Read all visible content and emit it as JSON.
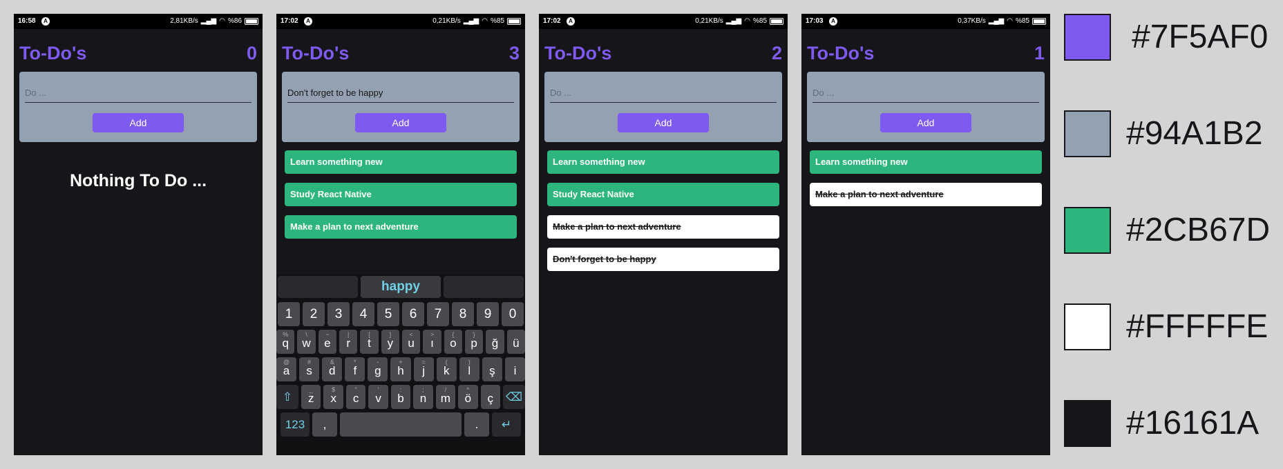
{
  "app_title": "To-Do's",
  "placeholder": "Do ...",
  "add_label": "Add",
  "empty_text": "Nothing To Do ...",
  "screens": [
    {
      "status": {
        "time": "16:58",
        "net": "2,81KB/s",
        "battery": "%86"
      },
      "count": "0",
      "input_value": "",
      "todos": []
    },
    {
      "status": {
        "time": "17:02",
        "net": "0,21KB/s",
        "battery": "%85"
      },
      "count": "3",
      "input_value": "Don't forget to be happy",
      "todos": [
        {
          "text": "Learn something new",
          "done": false
        },
        {
          "text": "Study React Native",
          "done": false
        },
        {
          "text": "Make a plan to next adventure",
          "done": false
        }
      ]
    },
    {
      "status": {
        "time": "17:02",
        "net": "0,21KB/s",
        "battery": "%85"
      },
      "count": "2",
      "input_value": "",
      "todos": [
        {
          "text": "Learn something new",
          "done": false
        },
        {
          "text": "Study React Native",
          "done": false
        },
        {
          "text": "Make a plan to next adventure",
          "done": true
        },
        {
          "text": "Don't forget to be happy",
          "done": true
        }
      ]
    },
    {
      "status": {
        "time": "17:03",
        "net": "0,37KB/s",
        "battery": "%85"
      },
      "count": "1",
      "input_value": "",
      "todos": [
        {
          "text": "Learn something new",
          "done": false
        },
        {
          "text": "Make a plan to next adventure",
          "done": true
        }
      ]
    }
  ],
  "keyboard": {
    "suggestion": "happy",
    "numbers": [
      "1",
      "2",
      "3",
      "4",
      "5",
      "6",
      "7",
      "8",
      "9",
      "0"
    ],
    "row1": [
      "q",
      "w",
      "e",
      "r",
      "t",
      "y",
      "u",
      "ı",
      "o",
      "p",
      "ğ",
      "ü"
    ],
    "row1_sub": [
      "%",
      "\\",
      "~",
      "|",
      "[",
      "]",
      "<",
      ">",
      "{",
      "}",
      "",
      ""
    ],
    "row2": [
      "a",
      "s",
      "d",
      "f",
      "g",
      "h",
      "j",
      "k",
      "l",
      "ş",
      "i"
    ],
    "row2_sub": [
      "@",
      "#",
      "&",
      "*",
      "-",
      "+",
      "=",
      "(",
      ")",
      "",
      ""
    ],
    "row3": [
      "z",
      "x",
      "c",
      "v",
      "b",
      "n",
      "m",
      "ö",
      "ç"
    ],
    "row3_sub": [
      "_",
      "$",
      "\"",
      "'",
      ":",
      ";",
      "/",
      "^",
      ""
    ],
    "mode_key": "123",
    "comma_key": ",",
    "period_key": "."
  },
  "palette": [
    "#7F5AF0",
    "#94A1B2",
    "#2CB67D",
    "#FFFFFE",
    "#16161A"
  ]
}
